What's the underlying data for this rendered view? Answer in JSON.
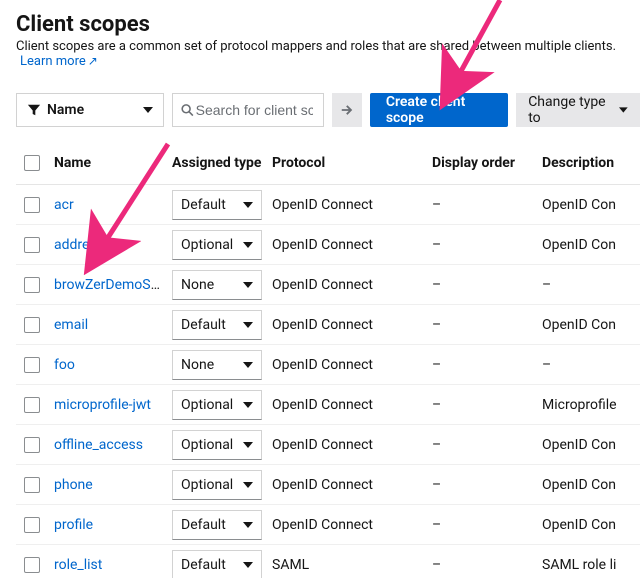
{
  "header": {
    "title": "Client scopes",
    "subtitle": "Client scopes are a common set of protocol mappers and roles that are shared between multiple clients.",
    "learn_more": "Learn more"
  },
  "toolbar": {
    "filter_label": "Name",
    "search_placeholder": "Search for client scope",
    "create_label": "Create client scope",
    "change_type_label": "Change type to"
  },
  "columns": {
    "name": "Name",
    "assigned": "Assigned type",
    "protocol": "Protocol",
    "display_order": "Display order",
    "description": "Description"
  },
  "type_options": [
    "Default",
    "Optional",
    "None"
  ],
  "rows": [
    {
      "name": "acr",
      "assigned": "Default",
      "protocol": "OpenID Connect",
      "display_order": "–",
      "description": "OpenID Con"
    },
    {
      "name": "address",
      "assigned": "Optional",
      "protocol": "OpenID Connect",
      "display_order": "–",
      "description": "OpenID Con"
    },
    {
      "name": "browZerDemoScope",
      "assigned": "None",
      "protocol": "OpenID Connect",
      "display_order": "–",
      "description": "–"
    },
    {
      "name": "email",
      "assigned": "Default",
      "protocol": "OpenID Connect",
      "display_order": "–",
      "description": "OpenID Con"
    },
    {
      "name": "foo",
      "assigned": "None",
      "protocol": "OpenID Connect",
      "display_order": "–",
      "description": "–"
    },
    {
      "name": "microprofile-jwt",
      "assigned": "Optional",
      "protocol": "OpenID Connect",
      "display_order": "–",
      "description": "Microprofile"
    },
    {
      "name": "offline_access",
      "assigned": "Optional",
      "protocol": "OpenID Connect",
      "display_order": "–",
      "description": "OpenID Con"
    },
    {
      "name": "phone",
      "assigned": "Optional",
      "protocol": "OpenID Connect",
      "display_order": "–",
      "description": "OpenID Con"
    },
    {
      "name": "profile",
      "assigned": "Default",
      "protocol": "OpenID Connect",
      "display_order": "–",
      "description": "OpenID Con"
    },
    {
      "name": "role_list",
      "assigned": "Default",
      "protocol": "SAML",
      "display_order": "–",
      "description": "SAML role li"
    }
  ],
  "colors": {
    "primary": "#0066cc",
    "link": "#0066cc",
    "annotation": "#ec297b"
  }
}
